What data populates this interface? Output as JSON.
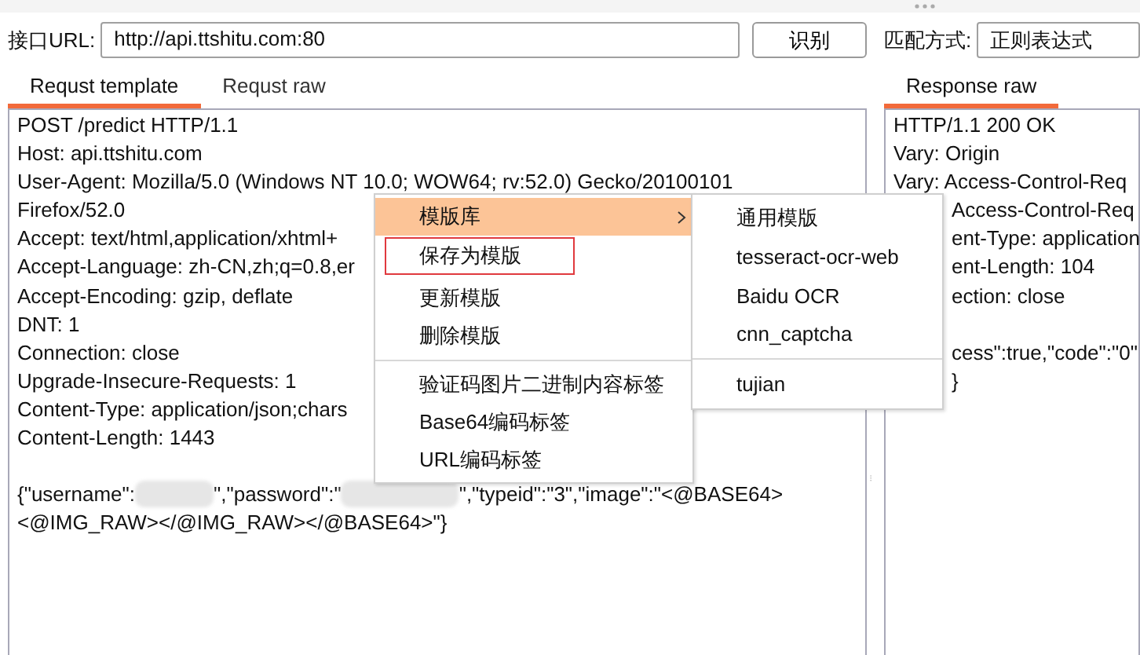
{
  "url_bar": {
    "label": "接口URL:",
    "value": "http://api.ttshitu.com:80",
    "button": "识别"
  },
  "match": {
    "label": "匹配方式:",
    "value": "正则表达式"
  },
  "request_tabs": [
    {
      "label": "Requst template",
      "selected": true
    },
    {
      "label": "Requst raw",
      "selected": false
    }
  ],
  "request_lines": [
    "POST /predict HTTP/1.1",
    "Host: api.ttshitu.com",
    "User-Agent: Mozilla/5.0 (Windows NT 10.0; WOW64; rv:52.0) Gecko/20100101",
    "Firefox/52.0",
    "Accept: text/html,application/xhtml+",
    "Accept-Language: zh-CN,zh;q=0.8,er",
    "Accept-Encoding: gzip, deflate",
    "DNT: 1",
    "Connection: close",
    "Upgrade-Insecure-Requests: 1",
    "Content-Type: application/json;chars",
    "Content-Length: 1443"
  ],
  "request_body": [
    [
      {
        "kind": "text",
        "text": "{\"username\":"
      },
      {
        "kind": "redacted"
      },
      {
        "kind": "text",
        "text": "\",\"password\":\""
      },
      {
        "kind": "redacted"
      },
      {
        "kind": "text",
        "text": "\",\"typeid\":\"3\",\"image\":\"<@BASE64>"
      }
    ],
    [
      {
        "kind": "text",
        "text": "<@IMG_RAW></@IMG_RAW></@BASE64>\"}"
      }
    ]
  ],
  "response_tabs": [
    {
      "label": "Response raw",
      "selected": true
    }
  ],
  "response_lines": [
    {
      "text": "HTTP/1.1 200 OK",
      "partly_hidden": false,
      "space_before": false
    },
    {
      "text": "Vary: Origin",
      "partly_hidden": false,
      "space_before": false
    },
    {
      "text": "Vary: Access-Control-Req",
      "partly_hidden": false,
      "space_before": false
    },
    {
      "text": "Access-Control-Req",
      "partly_hidden": true,
      "space_before": false
    },
    {
      "text": "ent-Type: application",
      "partly_hidden": true,
      "space_before": false
    },
    {
      "text": "ent-Length: 104",
      "partly_hidden": true,
      "space_before": false
    },
    {
      "text": "ection: close",
      "partly_hidden": true,
      "space_before": false
    },
    {
      "text": "cess\":true,\"code\":\"0\"",
      "partly_hidden": true,
      "space_before": true
    },
    {
      "text": "}",
      "partly_hidden": true,
      "space_before": false
    }
  ],
  "context_menu": [
    {
      "kind": "item",
      "label": "模版库",
      "highlighted": true,
      "marked": false,
      "submenu": true
    },
    {
      "kind": "item",
      "label": "保存为模版",
      "highlighted": false,
      "marked": true,
      "submenu": false
    },
    {
      "kind": "item",
      "label": "更新模版",
      "highlighted": false,
      "marked": false,
      "submenu": false
    },
    {
      "kind": "item",
      "label": "删除模版",
      "highlighted": false,
      "marked": false,
      "submenu": false
    },
    {
      "kind": "separator"
    },
    {
      "kind": "item",
      "label": "验证码图片二进制内容标签",
      "highlighted": false,
      "marked": false,
      "submenu": false
    },
    {
      "kind": "item",
      "label": "Base64编码标签",
      "highlighted": false,
      "marked": false,
      "submenu": false
    },
    {
      "kind": "item",
      "label": "URL编码标签",
      "highlighted": false,
      "marked": false,
      "submenu": false
    }
  ],
  "submenu": [
    {
      "kind": "item",
      "label": "通用模版"
    },
    {
      "kind": "item",
      "label": "tesseract-ocr-web"
    },
    {
      "kind": "item",
      "label": "Baidu OCR"
    },
    {
      "kind": "item",
      "label": "cnn_captcha"
    },
    {
      "kind": "separator"
    },
    {
      "kind": "item",
      "label": "tujian"
    }
  ]
}
